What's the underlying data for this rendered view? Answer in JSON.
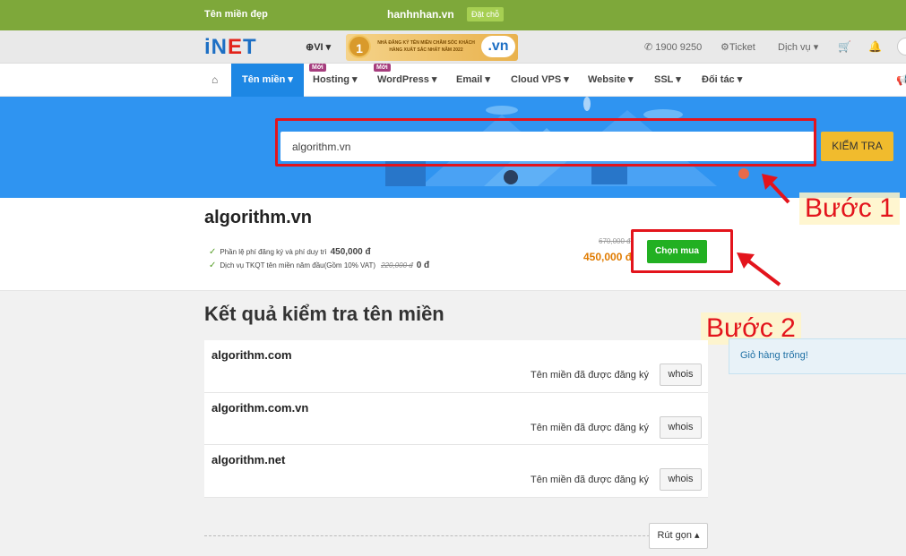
{
  "promo": {
    "left_text": "Tên miền đẹp",
    "center_domain": "hanhnhan.vn",
    "badge": "Đặt chỗ"
  },
  "header": {
    "logo": [
      "i",
      "N",
      "E",
      "T"
    ],
    "language": "VI",
    "award_rank": "1",
    "award_text": "NHÀ ĐĂNG KÝ TÊN MIỀN CHĂM SÓC KHÁCH HÀNG XUẤT SẮC NHẤT NĂM 2022",
    "award_badge": ".vn",
    "phone": "1900 9250",
    "ticket": "Ticket",
    "services": "Dịch vụ"
  },
  "nav": {
    "tabs": [
      {
        "label": "Tên miền"
      },
      {
        "label": "Hosting",
        "badge": "Mới"
      },
      {
        "label": "WordPress",
        "badge": "Mới"
      },
      {
        "label": "Email"
      },
      {
        "label": "Cloud VPS"
      },
      {
        "label": "Website"
      },
      {
        "label": "SSL"
      },
      {
        "label": "Đối tác"
      }
    ]
  },
  "search": {
    "value": "algorithm.vn",
    "button": "KIỂM TRA"
  },
  "result": {
    "domain": "algorithm.vn",
    "features": [
      {
        "text": "Phần lệ phí đăng ký và phí duy trì",
        "price": "450,000 đ"
      },
      {
        "text": "Dịch vụ TKQT tên miền năm đầu(Gồm 10% VAT)",
        "old_price": "220,000 đ",
        "price": "0 đ"
      }
    ],
    "old_price": "670,000 đ",
    "price": "450,000 đ",
    "buy_button": "Chọn mua"
  },
  "annotations": {
    "step1": "Bước 1",
    "step2": "Bước 2"
  },
  "check_results": {
    "title": "Kết quả kiểm tra tên miền",
    "rows": [
      {
        "domain": "algorithm.com",
        "status": "Tên miền đã được đăng ký",
        "action": "whois"
      },
      {
        "domain": "algorithm.com.vn",
        "status": "Tên miền đã được đăng ký",
        "action": "whois"
      },
      {
        "domain": "algorithm.net",
        "status": "Tên miền đã được đăng ký",
        "action": "whois"
      }
    ],
    "collapse": "Rút gọn"
  },
  "cart": {
    "text": "Giỏ hàng trống!"
  },
  "colors": {
    "promo_bg": "#7ea83a",
    "nav_active": "#1d87e4",
    "hero_bg": "#2f94f1",
    "check_button": "#f1bb2d",
    "buy_button": "#22b022",
    "annotation": "#e3141c",
    "price": "#e07b00"
  }
}
